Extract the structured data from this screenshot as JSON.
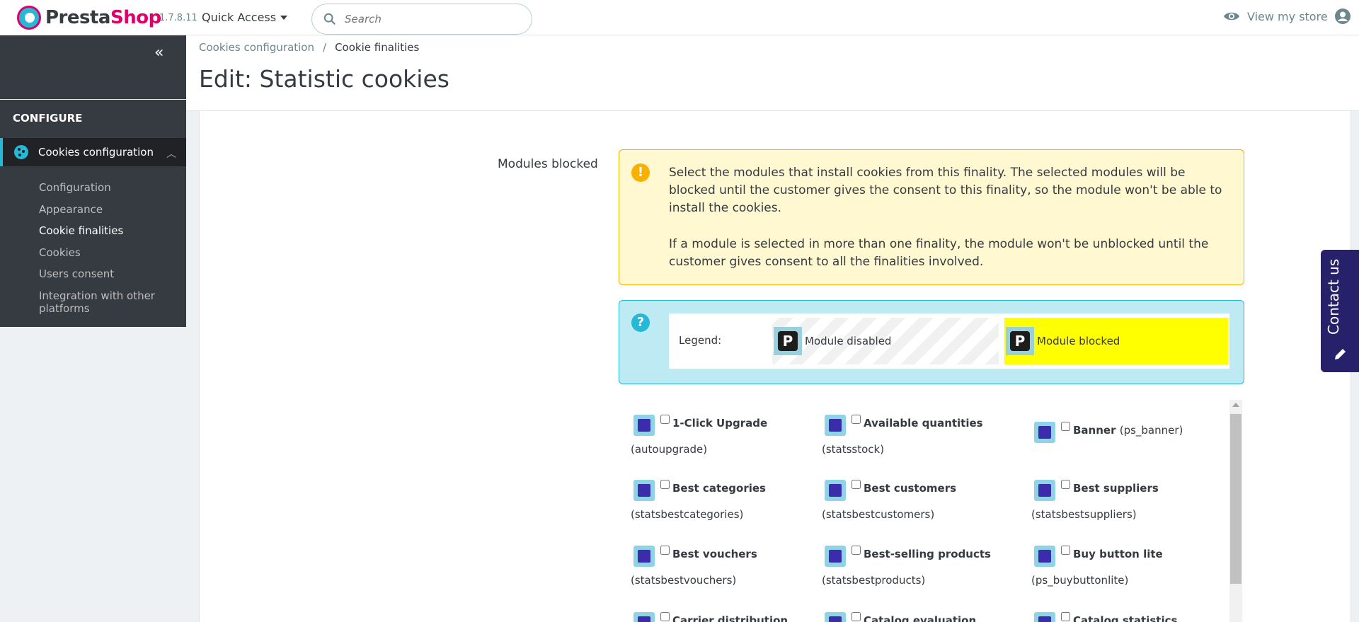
{
  "header": {
    "brand_presta": "Presta",
    "brand_shop": "Shop",
    "version": "1.7.8.11",
    "quick_access": "Quick Access",
    "search_placeholder": "Search",
    "view_store": "View my store"
  },
  "sidebar": {
    "section": "CONFIGURE",
    "active_item": "Cookies configuration",
    "items": [
      {
        "label": "Configuration"
      },
      {
        "label": "Appearance"
      },
      {
        "label": "Cookie finalities"
      },
      {
        "label": "Cookies"
      },
      {
        "label": "Users consent"
      },
      {
        "label": "Integration with other platforms"
      }
    ]
  },
  "breadcrumb": {
    "parent": "Cookies configuration",
    "current": "Cookie finalities"
  },
  "page_title": "Edit: Statistic cookies",
  "form": {
    "modules_label": "Modules blocked",
    "warning_p1": "Select the modules that install cookies from this finality. The selected modules will be blocked until the customer gives the consent to this finality, so the module won't be able to install the cookies.",
    "warning_p2": "If a module is selected in more than one finality, the module won't be unblocked until the customer gives consent to all the finalities involved.",
    "legend_label": "Legend:",
    "legend_disabled": "Module disabled",
    "legend_blocked": "Module blocked",
    "modules": [
      {
        "name": "1-Click Upgrade",
        "tech": "(autoupgrade)"
      },
      {
        "name": "Available quantities",
        "tech": "(statsstock)"
      },
      {
        "name": "Banner",
        "tech": "(ps_banner)"
      },
      {
        "name": "Best categories",
        "tech": "(statsbestcategories)"
      },
      {
        "name": "Best customers",
        "tech": "(statsbestcustomers)"
      },
      {
        "name": "Best suppliers",
        "tech": "(statsbestsuppliers)"
      },
      {
        "name": "Best vouchers",
        "tech": "(statsbestvouchers)"
      },
      {
        "name": "Best-selling products",
        "tech": "(statsbestproducts)"
      },
      {
        "name": "Buy button lite",
        "tech": "(ps_buybuttonlite)"
      },
      {
        "name": "Carrier distribution",
        "tech": ""
      },
      {
        "name": "Catalog evaluation",
        "tech": ""
      },
      {
        "name": "Catalog statistics",
        "tech": ""
      }
    ]
  },
  "contact": {
    "label": "Contact us"
  },
  "colors": {
    "sidebar_dark": "#363a41",
    "accent": "#25b9d7",
    "brand_pink": "#df0067",
    "warning_bg": "#fff8d1",
    "info_bg": "#beeaf3",
    "blocked_yellow": "#ffff00",
    "contact_bg": "#27206b"
  },
  "icons": [
    "search-icon",
    "eye-icon",
    "user-icon",
    "collapse-icon",
    "cookie-icon",
    "chevron-up-icon",
    "warning-icon",
    "help-icon",
    "pencil-icon"
  ]
}
